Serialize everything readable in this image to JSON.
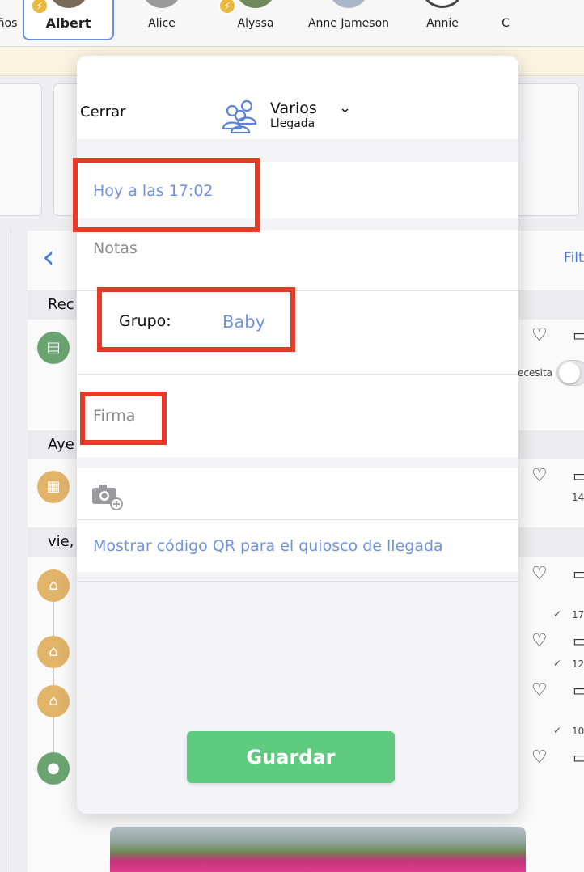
{
  "kids": [
    {
      "name": "ños",
      "badge": false
    },
    {
      "name": "Albert",
      "badge": true,
      "selected": true
    },
    {
      "name": "Alice",
      "badge": false
    },
    {
      "name": "Alyssa",
      "badge": true
    },
    {
      "name": "Anne Jameson",
      "badge": false
    },
    {
      "name": "Annie",
      "badge": false
    },
    {
      "name": "C",
      "badge": false
    }
  ],
  "background": {
    "filter_label": "Filt",
    "sections": [
      "Rec",
      "Aye",
      "vie,"
    ],
    "needs_label": "ecesita",
    "counts": [
      "14",
      "17",
      "12",
      "10"
    ]
  },
  "modal": {
    "close_label": "Cerrar",
    "checkin_type": "Varios",
    "checkin_subtype": "Llegada",
    "time_value": "Hoy a las 17:02",
    "notes_placeholder": "Notas",
    "group_label": "Grupo:",
    "group_value": "Baby",
    "signature_placeholder": "Firma",
    "qr_link": "Mostrar código QR para el quiosco de llegada",
    "save_label": "Guardar"
  },
  "colors": {
    "accent_blue": "#6f93de",
    "save_green": "#5fcb80",
    "highlight_red": "#e53b26",
    "badge_yellow": "#e8b93e"
  },
  "icons": [
    "group-icon",
    "chevron-down-icon",
    "camera-add-icon",
    "back-chevron-icon",
    "heart-icon",
    "comment-icon",
    "clipboard-icon",
    "calendar-icon",
    "home-icon",
    "chat-icon",
    "checkmark-icon"
  ]
}
